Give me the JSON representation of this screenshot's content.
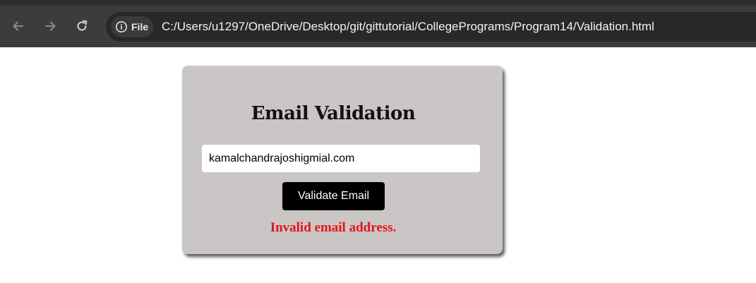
{
  "browser": {
    "chip_label": "File",
    "url": "C:/Users/u1297/OneDrive/Desktop/git/gittutorial/CollegePrograms/Program14/Validation.html",
    "icons": {
      "back": "arrow-left-icon",
      "forward": "arrow-right-icon",
      "reload": "reload-icon",
      "info": "info-circle-icon"
    }
  },
  "form": {
    "title": "Email Validation",
    "email_value": "kamalchandrajoshigmial.com",
    "button_label": "Validate Email",
    "error_message": "Invalid email address."
  },
  "colors": {
    "card_background": "#cbc6c6",
    "button_background": "#000000",
    "error_text": "#e81313",
    "toolbar_background": "#3c3c3c"
  }
}
